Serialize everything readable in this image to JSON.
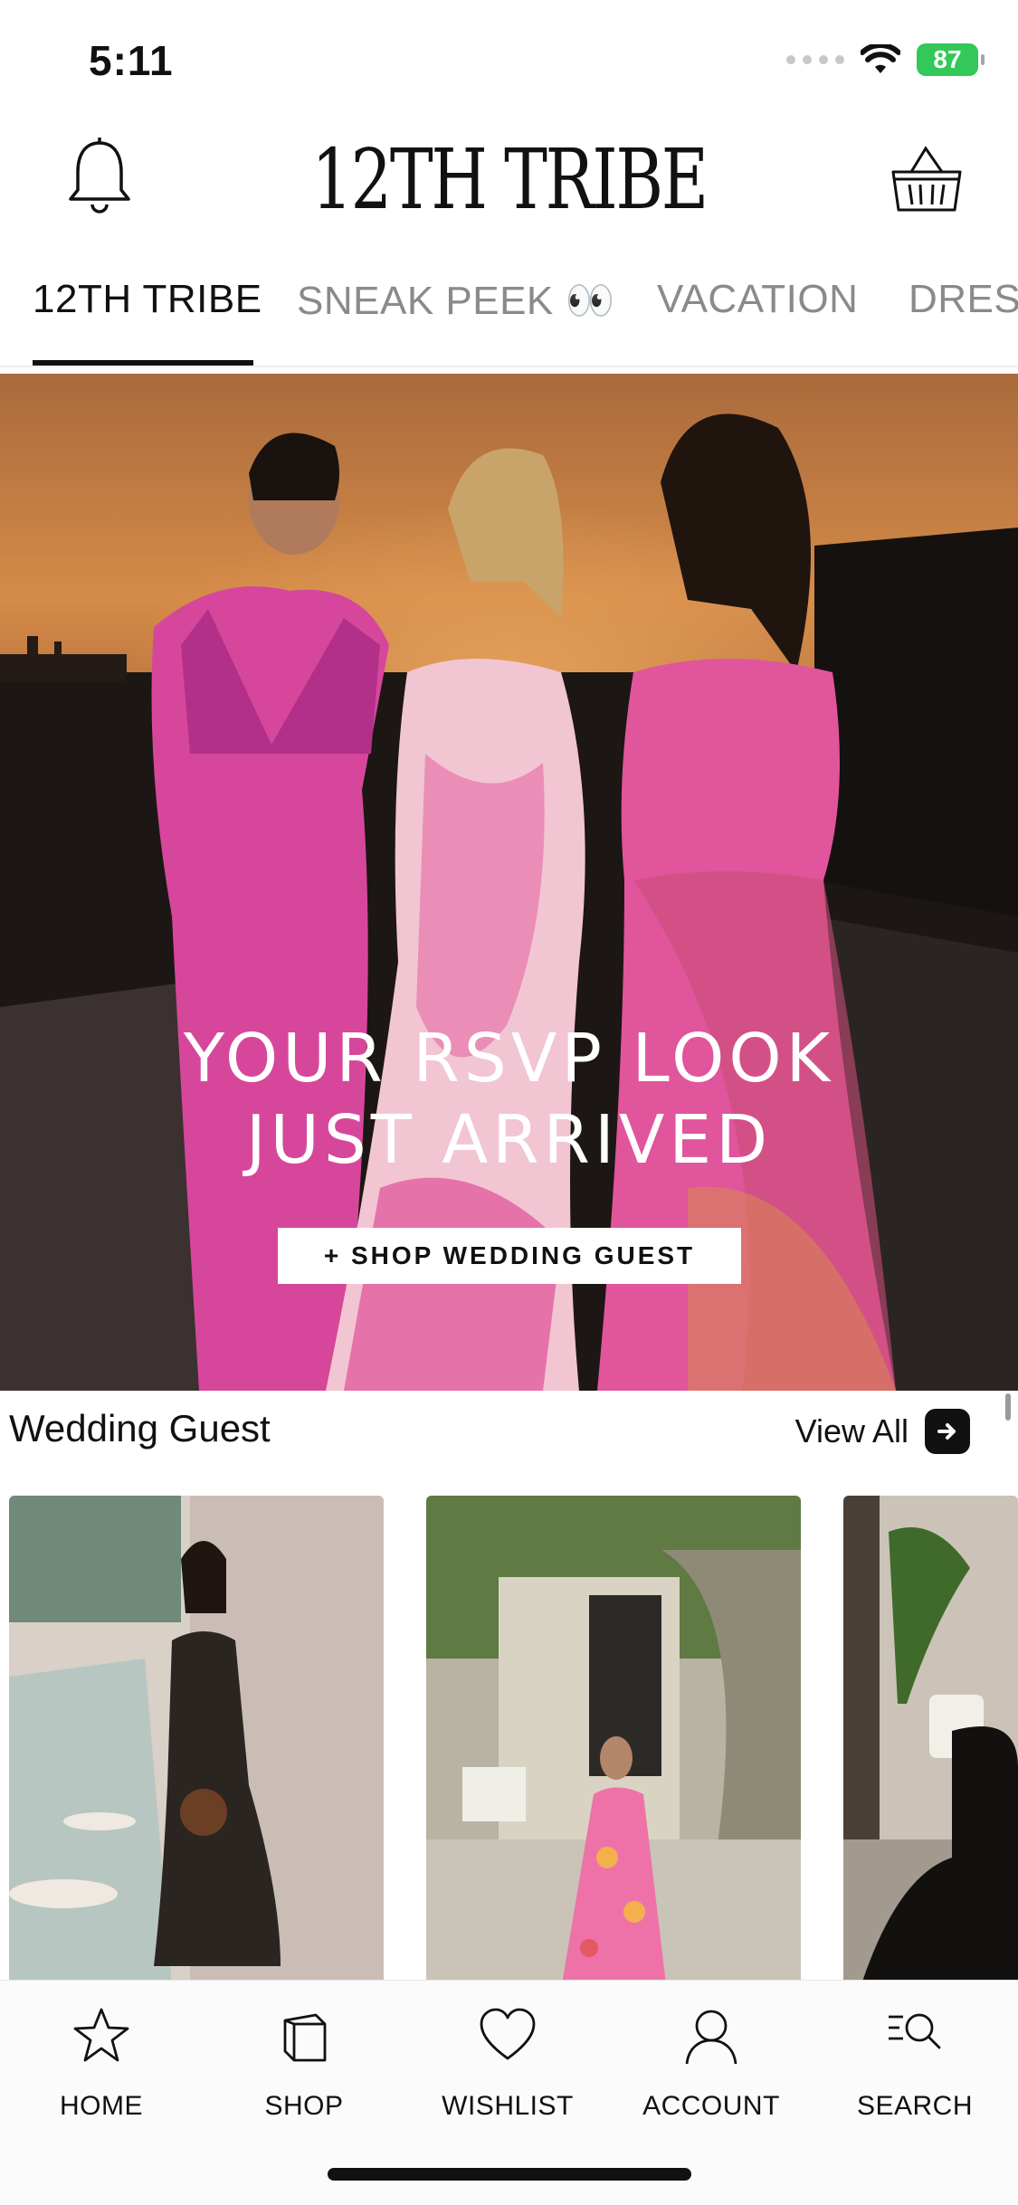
{
  "status_bar": {
    "time": "5:11",
    "battery": "87"
  },
  "header": {
    "brand": "12TH TRIBE",
    "bell_icon": "bell-icon",
    "basket_icon": "basket-icon"
  },
  "tabs": [
    {
      "label": "12TH TRIBE",
      "active": true
    },
    {
      "label": "SNEAK PEEK 👀",
      "active": false
    },
    {
      "label": "VACATION",
      "active": false
    },
    {
      "label": "DRES",
      "active": false
    }
  ],
  "hero": {
    "headline_line1": "YOUR RSVP LOOK",
    "headline_line2": "JUST ARRIVED",
    "cta_label": "+ SHOP WEDDING GUEST"
  },
  "section": {
    "title": "Wedding Guest",
    "view_all_label": "View All",
    "view_all_icon": "arrow-right-icon"
  },
  "bottom_nav": [
    {
      "label": "HOME",
      "icon": "star-icon"
    },
    {
      "label": "SHOP",
      "icon": "shopping-bag-icon"
    },
    {
      "label": "WISHLIST",
      "icon": "heart-icon"
    },
    {
      "label": "ACCOUNT",
      "icon": "user-icon"
    },
    {
      "label": "SEARCH",
      "icon": "search-list-icon"
    }
  ],
  "colors": {
    "accent": "#111111",
    "battery": "#34c759",
    "hero_sky": "#d58b48",
    "dress_pink": "#d94a9a"
  }
}
